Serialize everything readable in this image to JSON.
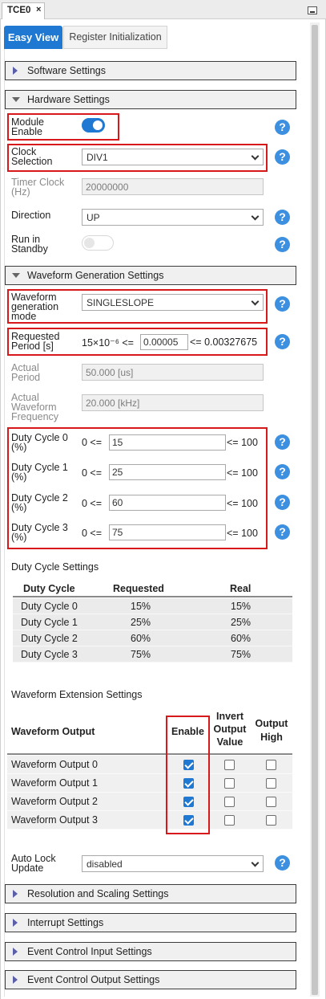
{
  "doc_tab": {
    "title": "TCE0",
    "close": "×"
  },
  "tabs": {
    "easy_view": "Easy View",
    "register_init": "Register Initialization"
  },
  "sections": {
    "software": "Software Settings",
    "hardware": "Hardware Settings",
    "waveform_gen": "Waveform Generation Settings",
    "resolution": "Resolution and Scaling Settings",
    "interrupt": "Interrupt Settings",
    "event_input": "Event Control Input Settings",
    "event_output": "Event Control Output Settings"
  },
  "help_glyph": "?",
  "hardware": {
    "module_enable": {
      "label1": "Module",
      "label2": "Enable",
      "enabled": true
    },
    "clock_selection": {
      "label1": "Clock",
      "label2": "Selection",
      "value": "DIV1"
    },
    "timer_clock": {
      "label1": "Timer Clock",
      "label2": "(Hz)",
      "value": "20000000"
    },
    "direction": {
      "label": "Direction",
      "value": "UP"
    },
    "run_in_standby": {
      "label1": "Run in",
      "label2": "Standby",
      "enabled": false
    }
  },
  "waveform": {
    "mode": {
      "label1": "Waveform",
      "label2": "generation",
      "label3": "mode",
      "value": "SINGLESLOPE"
    },
    "requested_period": {
      "label1": "Requested",
      "label2": "Period [s]",
      "min": "15×10⁻⁶ <=",
      "value": "0.00005",
      "max": "<= 0.00327675"
    },
    "actual_period": {
      "label1": "Actual",
      "label2": "Period",
      "value": "50.000 [us]"
    },
    "actual_frequency": {
      "label1": "Actual",
      "label2": "Waveform",
      "label3": "Frequency",
      "value": "20.000 [kHz]"
    },
    "duty_cycles": [
      {
        "label1": "Duty Cycle 0",
        "label2": "(%)",
        "min": "0 <=",
        "value": "15",
        "max": "<= 100"
      },
      {
        "label1": "Duty Cycle 1",
        "label2": "(%)",
        "min": "0 <=",
        "value": "25",
        "max": "<= 100"
      },
      {
        "label1": "Duty Cycle 2",
        "label2": "(%)",
        "min": "0 <=",
        "value": "60",
        "max": "<= 100"
      },
      {
        "label1": "Duty Cycle 3",
        "label2": "(%)",
        "min": "0 <=",
        "value": "75",
        "max": "<= 100"
      }
    ]
  },
  "duty_cycle_settings": {
    "title": "Duty Cycle Settings",
    "headers": {
      "name": "Duty Cycle",
      "requested": "Requested",
      "real": "Real"
    },
    "rows": [
      {
        "name": "Duty Cycle 0",
        "requested": "15%",
        "real": "15%"
      },
      {
        "name": "Duty Cycle 1",
        "requested": "25%",
        "real": "25%"
      },
      {
        "name": "Duty Cycle 2",
        "requested": "60%",
        "real": "60%"
      },
      {
        "name": "Duty Cycle 3",
        "requested": "75%",
        "real": "75%"
      }
    ]
  },
  "waveform_extension": {
    "title": "Waveform Extension Settings",
    "headers": {
      "output": "Waveform Output",
      "enable": "Enable",
      "invert1": "Invert",
      "invert2": "Output",
      "invert3": "Value",
      "high1": "Output",
      "high2": "High"
    },
    "rows": [
      {
        "name": "Waveform Output 0",
        "enable": true,
        "invert": false,
        "high": false
      },
      {
        "name": "Waveform Output 1",
        "enable": true,
        "invert": false,
        "high": false
      },
      {
        "name": "Waveform Output 2",
        "enable": true,
        "invert": false,
        "high": false
      },
      {
        "name": "Waveform Output 3",
        "enable": true,
        "invert": false,
        "high": false
      }
    ]
  },
  "auto_lock": {
    "label1": "Auto Lock",
    "label2": "Update",
    "value": "disabled"
  }
}
